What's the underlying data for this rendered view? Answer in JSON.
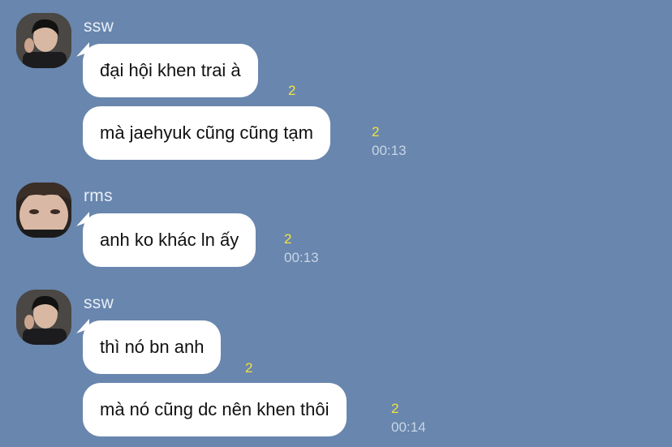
{
  "groups": [
    {
      "sender": "ssw",
      "avatar_icon": "profile-photo-ssw",
      "messages": [
        {
          "text": "đại hội khen trai à",
          "unread": "2",
          "time": ""
        },
        {
          "text": "mà jaehyuk cũng cũng tạm",
          "unread": "2",
          "time": "00:13"
        }
      ]
    },
    {
      "sender": "rms",
      "avatar_icon": "profile-photo-rms",
      "messages": [
        {
          "text": "anh ko khác ln ấy",
          "unread": "2",
          "time": "00:13"
        }
      ]
    },
    {
      "sender": "ssw",
      "avatar_icon": "profile-photo-ssw",
      "messages": [
        {
          "text": "thì nó bn anh",
          "unread": "2",
          "time": ""
        },
        {
          "text": "mà nó cũng dc nên khen thôi",
          "unread": "2",
          "time": "00:14"
        }
      ]
    }
  ],
  "colors": {
    "background": "#6886ae",
    "bubble": "#ffffff",
    "unread": "#f4e23c",
    "time": "#c9d5e5"
  }
}
